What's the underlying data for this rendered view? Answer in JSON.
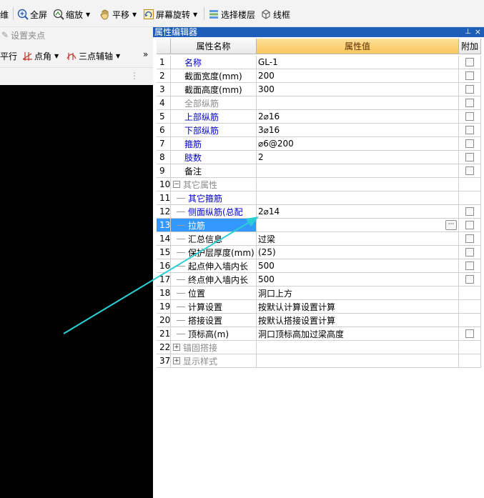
{
  "toolbar": {
    "items": [
      {
        "label": "维"
      },
      {
        "label": "全屏"
      },
      {
        "label": "缩放"
      },
      {
        "label": "平移"
      },
      {
        "label": "屏幕旋转"
      },
      {
        "label": "选择楼层"
      },
      {
        "label": "线框"
      }
    ]
  },
  "leftpanel": {
    "set_grip": "设置夹点",
    "row2": {
      "parallel": "平行",
      "point_angle": "点角",
      "three_point_axis": "三点辅轴",
      "more": "»"
    },
    "row3_handle": "⋮"
  },
  "editor": {
    "title": "属性编辑器",
    "pin": "⊥",
    "close": "×",
    "headers": {
      "name": "属性名称",
      "value": "属性值",
      "add": "附加"
    },
    "rows": [
      {
        "num": "1",
        "name": "名称",
        "value": "GL-1",
        "style": "blue",
        "check": false,
        "indent": 0
      },
      {
        "num": "2",
        "name": "截面宽度(mm)",
        "value": "200",
        "style": "normal",
        "check": true,
        "indent": 0
      },
      {
        "num": "3",
        "name": "截面高度(mm)",
        "value": "300",
        "style": "normal",
        "check": true,
        "indent": 0
      },
      {
        "num": "4",
        "name": "全部纵筋",
        "value": "",
        "style": "gray",
        "check": true,
        "indent": 0
      },
      {
        "num": "5",
        "name": "上部纵筋",
        "value": "2⌀16",
        "style": "blue",
        "check": true,
        "indent": 0
      },
      {
        "num": "6",
        "name": "下部纵筋",
        "value": "3⌀16",
        "style": "blue",
        "check": true,
        "indent": 0
      },
      {
        "num": "7",
        "name": "箍筋",
        "value": "⌀6@200",
        "style": "blue",
        "check": true,
        "indent": 0
      },
      {
        "num": "8",
        "name": "肢数",
        "value": "2",
        "style": "blue",
        "check": true,
        "indent": 0
      },
      {
        "num": "9",
        "name": "备注",
        "value": "",
        "style": "normal",
        "check": true,
        "indent": 0
      },
      {
        "num": "10",
        "name": "其它属性",
        "value": "",
        "style": "gray",
        "check": null,
        "indent": 0,
        "expander": "−"
      },
      {
        "num": "11",
        "name": "其它箍筋",
        "value": "",
        "style": "blue",
        "check": null,
        "indent": 1
      },
      {
        "num": "12",
        "name": "侧面纵筋(总配",
        "value": "2⌀14",
        "style": "blue",
        "check": true,
        "indent": 1
      },
      {
        "num": "13",
        "name": "拉筋",
        "value": "",
        "style": "selected",
        "check": true,
        "indent": 1,
        "ellipsis": "···"
      },
      {
        "num": "14",
        "name": "汇总信息",
        "value": "过梁",
        "style": "normal",
        "check": true,
        "indent": 1
      },
      {
        "num": "15",
        "name": "保护层厚度(mm)",
        "value": "(25)",
        "style": "normal",
        "check": true,
        "indent": 1
      },
      {
        "num": "16",
        "name": "起点伸入墙内长",
        "value": "500",
        "style": "normal",
        "check": true,
        "indent": 1
      },
      {
        "num": "17",
        "name": "终点伸入墙内长",
        "value": "500",
        "style": "normal",
        "check": true,
        "indent": 1
      },
      {
        "num": "18",
        "name": "位置",
        "value": "洞口上方",
        "style": "normal",
        "check": null,
        "indent": 1
      },
      {
        "num": "19",
        "name": "计算设置",
        "value": "按默认计算设置计算",
        "style": "normal",
        "check": null,
        "indent": 1
      },
      {
        "num": "20",
        "name": "搭接设置",
        "value": "按默认搭接设置计算",
        "style": "normal",
        "check": null,
        "indent": 1
      },
      {
        "num": "21",
        "name": "顶标高(m)",
        "value": "洞口顶标高加过梁高度",
        "style": "normal",
        "check": true,
        "indent": 1
      },
      {
        "num": "22",
        "name": "锚固搭接",
        "value": "",
        "style": "gray",
        "check": null,
        "indent": 0,
        "expander": "+"
      },
      {
        "num": "37",
        "name": "显示样式",
        "value": "",
        "style": "gray",
        "check": null,
        "indent": 0,
        "expander": "+"
      }
    ]
  },
  "colors": {
    "title_bar": "#1e5eb8",
    "value_header": "#f8c65c",
    "selection": "#3399ff",
    "blue_text": "#0000c8",
    "arrow": "#2ccfd4"
  }
}
